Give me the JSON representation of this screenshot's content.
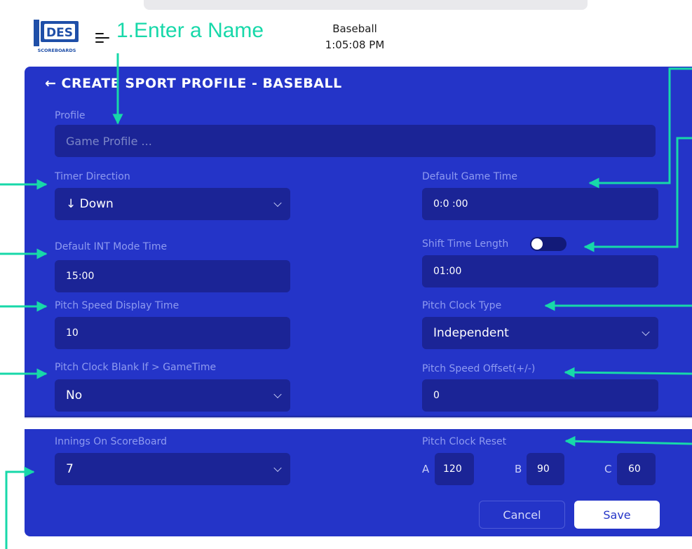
{
  "header": {
    "logo_text": "DES",
    "logo_subtext": "SCOREBOARDS",
    "annotation": "1.Enter a Name",
    "sport": "Baseball",
    "time": "1:05:08 PM"
  },
  "form": {
    "title": "← CREATE SPORT PROFILE - BASEBALL",
    "profile": {
      "label": "Profile",
      "placeholder": "Game Profile ..."
    },
    "timer_direction": {
      "label": "Timer Direction",
      "value": "↓ Down"
    },
    "default_game_time": {
      "label": "Default Game Time",
      "value": "0:0 :00"
    },
    "default_int_mode_time": {
      "label": "Default INT Mode Time",
      "value": "15:00"
    },
    "shift_time_length": {
      "label": "Shift Time Length",
      "value": "01:00",
      "toggle_on": false
    },
    "pitch_speed_display_time": {
      "label": "Pitch Speed Display Time",
      "value": "10"
    },
    "pitch_clock_type": {
      "label": "Pitch Clock Type",
      "value": "Independent"
    },
    "pitch_clock_blank": {
      "label": "Pitch Clock Blank If > GameTime",
      "value": "No"
    },
    "pitch_speed_offset": {
      "label": "Pitch Speed Offset(+/-)",
      "value": "0"
    },
    "innings_on_scoreboard": {
      "label": "Innings On ScoreBoard",
      "value": "7"
    },
    "pitch_clock_reset": {
      "label": "Pitch Clock Reset",
      "a_label": "A",
      "a_value": "120",
      "b_label": "B",
      "b_value": "90",
      "c_label": "C",
      "c_value": "60"
    }
  },
  "actions": {
    "cancel": "Cancel",
    "save": "Save"
  },
  "colors": {
    "panel": "#2434c8",
    "field": "#1b2496",
    "label": "#8f9bf0",
    "annotation_arrow": "#17d8a9"
  },
  "icons": [
    "menu-icon",
    "back-arrow-icon",
    "chevron-down-icon",
    "toggle-switch"
  ]
}
